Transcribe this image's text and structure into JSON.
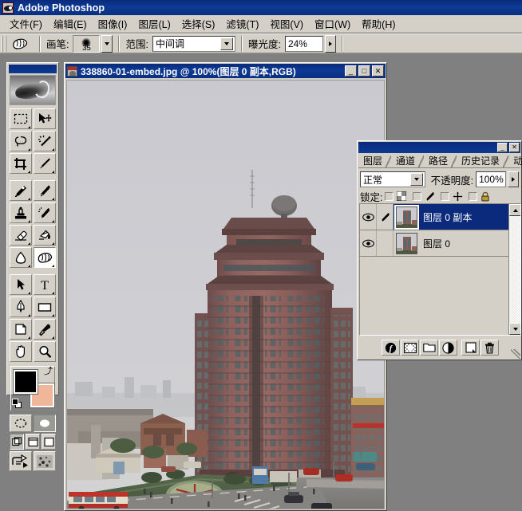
{
  "app": {
    "title": "Adobe Photoshop",
    "icon": "photoshop-eye-icon",
    "background_color": "#808080",
    "titlebar_color": "#0c3a95"
  },
  "menubar": {
    "items": [
      {
        "label": "文件(F)",
        "name": "menu-file"
      },
      {
        "label": "编辑(E)",
        "name": "menu-edit"
      },
      {
        "label": "图像(I)",
        "name": "menu-image"
      },
      {
        "label": "图层(L)",
        "name": "menu-layer"
      },
      {
        "label": "选择(S)",
        "name": "menu-select"
      },
      {
        "label": "滤镜(T)",
        "name": "menu-filter"
      },
      {
        "label": "视图(V)",
        "name": "menu-view"
      },
      {
        "label": "窗口(W)",
        "name": "menu-window"
      },
      {
        "label": "帮助(H)",
        "name": "menu-help"
      }
    ]
  },
  "options_bar": {
    "tool_icon": "dodge-tool-icon",
    "brush_label": "画笔:",
    "brush_size": "35",
    "range_label": "范围:",
    "range_value": "中间调",
    "exposure_label": "曝光度:",
    "exposure_value": "24%"
  },
  "toolbox": {
    "logo": "photoshop-feather-logo",
    "tools": [
      {
        "name": "rectangular-marquee-tool",
        "label": "矩形选框工具"
      },
      {
        "name": "move-tool",
        "label": "移动工具"
      },
      {
        "name": "lasso-tool",
        "label": "套索工具"
      },
      {
        "name": "magic-wand-tool",
        "label": "魔棒工具"
      },
      {
        "name": "crop-tool",
        "label": "裁剪工具"
      },
      {
        "name": "slice-tool",
        "label": "切片工具"
      },
      {
        "name": "healing-brush-tool",
        "label": "修复画笔工具"
      },
      {
        "name": "brush-tool",
        "label": "画笔工具"
      },
      {
        "name": "stamp-tool",
        "label": "图章工具"
      },
      {
        "name": "history-brush-tool",
        "label": "历史记录画笔工具"
      },
      {
        "name": "eraser-tool",
        "label": "橡皮擦工具"
      },
      {
        "name": "gradient-tool",
        "label": "渐变工具"
      },
      {
        "name": "blur-tool",
        "label": "模糊工具"
      },
      {
        "name": "dodge-tool",
        "label": "减淡工具",
        "active": true
      },
      {
        "name": "path-selection-tool",
        "label": "路径选择工具"
      },
      {
        "name": "type-tool",
        "label": "文字工具"
      },
      {
        "name": "pen-tool",
        "label": "钢笔工具"
      },
      {
        "name": "rectangle-shape-tool",
        "label": "矩形工具"
      },
      {
        "name": "notes-tool",
        "label": "注释工具"
      },
      {
        "name": "eyedropper-tool",
        "label": "吸管工具"
      },
      {
        "name": "hand-tool",
        "label": "抓手工具"
      },
      {
        "name": "zoom-tool",
        "label": "缩放工具"
      }
    ],
    "colors": {
      "foreground": "#000000",
      "background": "#f0b699",
      "swap_icon": "swap-colors-icon",
      "default_icon": "default-colors-icon"
    },
    "mask_modes": [
      {
        "name": "standard-mode-icon",
        "on": false
      },
      {
        "name": "quick-mask-mode-icon",
        "on": true
      }
    ],
    "screen_modes": [
      {
        "name": "standard-screen-mode-icon",
        "on": true
      },
      {
        "name": "full-screen-menubar-mode-icon",
        "on": false
      },
      {
        "name": "full-screen-mode-icon",
        "on": false
      }
    ],
    "jump_buttons": [
      {
        "name": "jump-to-imageready-icon"
      },
      {
        "name": "jump-to-other-icon"
      }
    ]
  },
  "document_window": {
    "icon": "image-document-icon",
    "title": "338860-01-embed.jpg @ 100%(图层 0 副本,RGB)",
    "filename": "338860-01-embed.jpg",
    "zoom": "100%",
    "layer_in_title": "图层 0 副本",
    "color_mode": "RGB",
    "controls": {
      "minimize": "_",
      "maximize": "□",
      "close": "✕"
    },
    "image_description": "高层红砖住宅楼与城市街道俯视照片"
  },
  "layers_panel": {
    "titlebar_buttons": {
      "minimize": "_",
      "close": "✕"
    },
    "tabs": [
      {
        "label": "图层",
        "name": "tab-layers",
        "active": true
      },
      {
        "label": "通道",
        "name": "tab-channels",
        "active": false
      },
      {
        "label": "路径",
        "name": "tab-paths",
        "active": false
      },
      {
        "label": "历史记录",
        "name": "tab-history",
        "active": false
      },
      {
        "label": "动作",
        "name": "tab-actions",
        "active": false
      }
    ],
    "more_icon": "panel-menu-arrow-icon",
    "blend_mode": "正常",
    "opacity_label": "不透明度:",
    "opacity_value": "100%",
    "lock_label": "锁定:",
    "lock_toggles": [
      {
        "name": "lock-transparency-checkbox",
        "icon": "checker-square-icon",
        "checked": false
      },
      {
        "name": "lock-image-checkbox",
        "icon": "brush-icon",
        "checked": false
      },
      {
        "name": "lock-position-checkbox",
        "icon": "move-cross-icon",
        "checked": false
      },
      {
        "name": "lock-all-checkbox",
        "icon": "padlock-icon",
        "checked": false
      }
    ],
    "layers": [
      {
        "name": "图层 0 副本",
        "visible": true,
        "has_brush_indicator": true,
        "selected": true,
        "thumbnail": "building-photo-thumb"
      },
      {
        "name": "图层 0",
        "visible": true,
        "has_brush_indicator": false,
        "selected": false,
        "thumbnail": "building-photo-thumb"
      }
    ],
    "footer_buttons": [
      {
        "name": "layer-style-button",
        "icon": "fx-icon"
      },
      {
        "name": "layer-mask-button",
        "icon": "mask-icon"
      },
      {
        "name": "new-group-button",
        "icon": "folder-icon"
      },
      {
        "name": "new-adjustment-layer-button",
        "icon": "half-circle-icon"
      },
      {
        "name": "new-layer-button",
        "icon": "new-page-icon"
      },
      {
        "name": "delete-layer-button",
        "icon": "trash-icon"
      }
    ],
    "scrollbar": {
      "up_arrow": "scroll-up-arrow-icon",
      "down_arrow": "scroll-down-arrow-icon"
    }
  }
}
